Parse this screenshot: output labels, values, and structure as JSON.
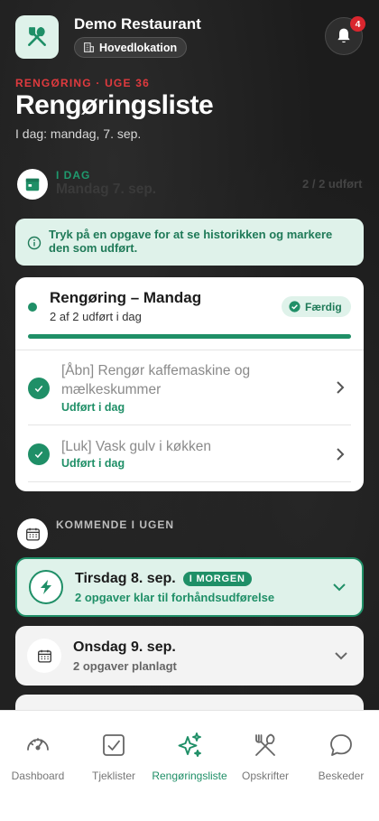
{
  "header": {
    "restaurant_name": "Demo Restaurant",
    "location": "Hovedlokation",
    "notifications_count": "4",
    "eyebrow": "RENGØRING · UGE 36",
    "title": "Rengøringsliste",
    "subtitle": "I dag: mandag, 7. sep."
  },
  "today": {
    "label": "I DAG",
    "date": "Mandag 7. sep.",
    "count": "2 / 2 udført"
  },
  "info": {
    "text": "Tryk på en opgave for at se historikken og markere den som udført."
  },
  "checklist": {
    "title": "Rengøring – Mandag",
    "subtitle": "2 af 2 udført i dag",
    "status": "Færdig",
    "progress": 1.0,
    "tasks": [
      {
        "name": "[Åbn] Rengør kaffemaskine og mælkeskummer",
        "status": "Udført i dag"
      },
      {
        "name": "[Luk] Vask gulv i køkken",
        "status": "Udført i dag"
      }
    ]
  },
  "upcoming": {
    "label": "KOMMENDE I UGEN",
    "days": [
      {
        "title": "Tirsdag 8. sep.",
        "badge": "I MORGEN",
        "subtitle": "2 opgaver klar til forhåndsudførelse"
      },
      {
        "title": "Onsdag 9. sep.",
        "subtitle": "2 opgaver planlagt"
      }
    ]
  },
  "nav": {
    "items": [
      {
        "label": "Dashboard",
        "icon": "gauge-icon"
      },
      {
        "label": "Tjeklister",
        "icon": "checkbox-icon"
      },
      {
        "label": "Rengøringsliste",
        "icon": "sparkles-icon"
      },
      {
        "label": "Opskrifter",
        "icon": "utensils-icon"
      },
      {
        "label": "Beskeder",
        "icon": "chat-bubble-icon"
      }
    ],
    "active": "Rengøringsliste"
  },
  "colors": {
    "accent": "#1f8f67",
    "accent_light": "#dff2ea",
    "alert": "#e03a3e",
    "badge": "#d9262e"
  }
}
